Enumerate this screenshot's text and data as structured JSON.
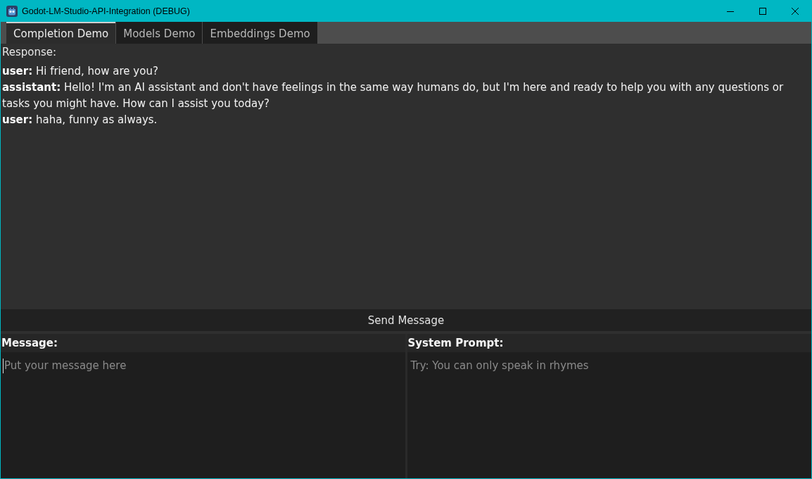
{
  "window": {
    "title": "Godot-LM-Studio-API-Integration (DEBUG)"
  },
  "tabs": [
    {
      "label": "Completion Demo",
      "selected": true
    },
    {
      "label": "Models Demo",
      "selected": false
    },
    {
      "label": "Embeddings Demo",
      "selected": false
    }
  ],
  "response": {
    "label": "Response:",
    "messages": [
      "**user:** Hi friend, how are you?",
      "**assistant:** Hello! I'm an AI assistant and don't have feelings in the same way humans do, but I'm here and ready to help you with any questions or tasks you might have. How can I assist you today?",
      "**user:** haha, funny as always."
    ]
  },
  "send_button": {
    "label": "Send Message"
  },
  "message": {
    "label": "Message:",
    "placeholder": "Put your message here",
    "focused": true
  },
  "system_prompt": {
    "label": "System Prompt:",
    "placeholder": "Try: You can only speak in rhymes"
  }
}
